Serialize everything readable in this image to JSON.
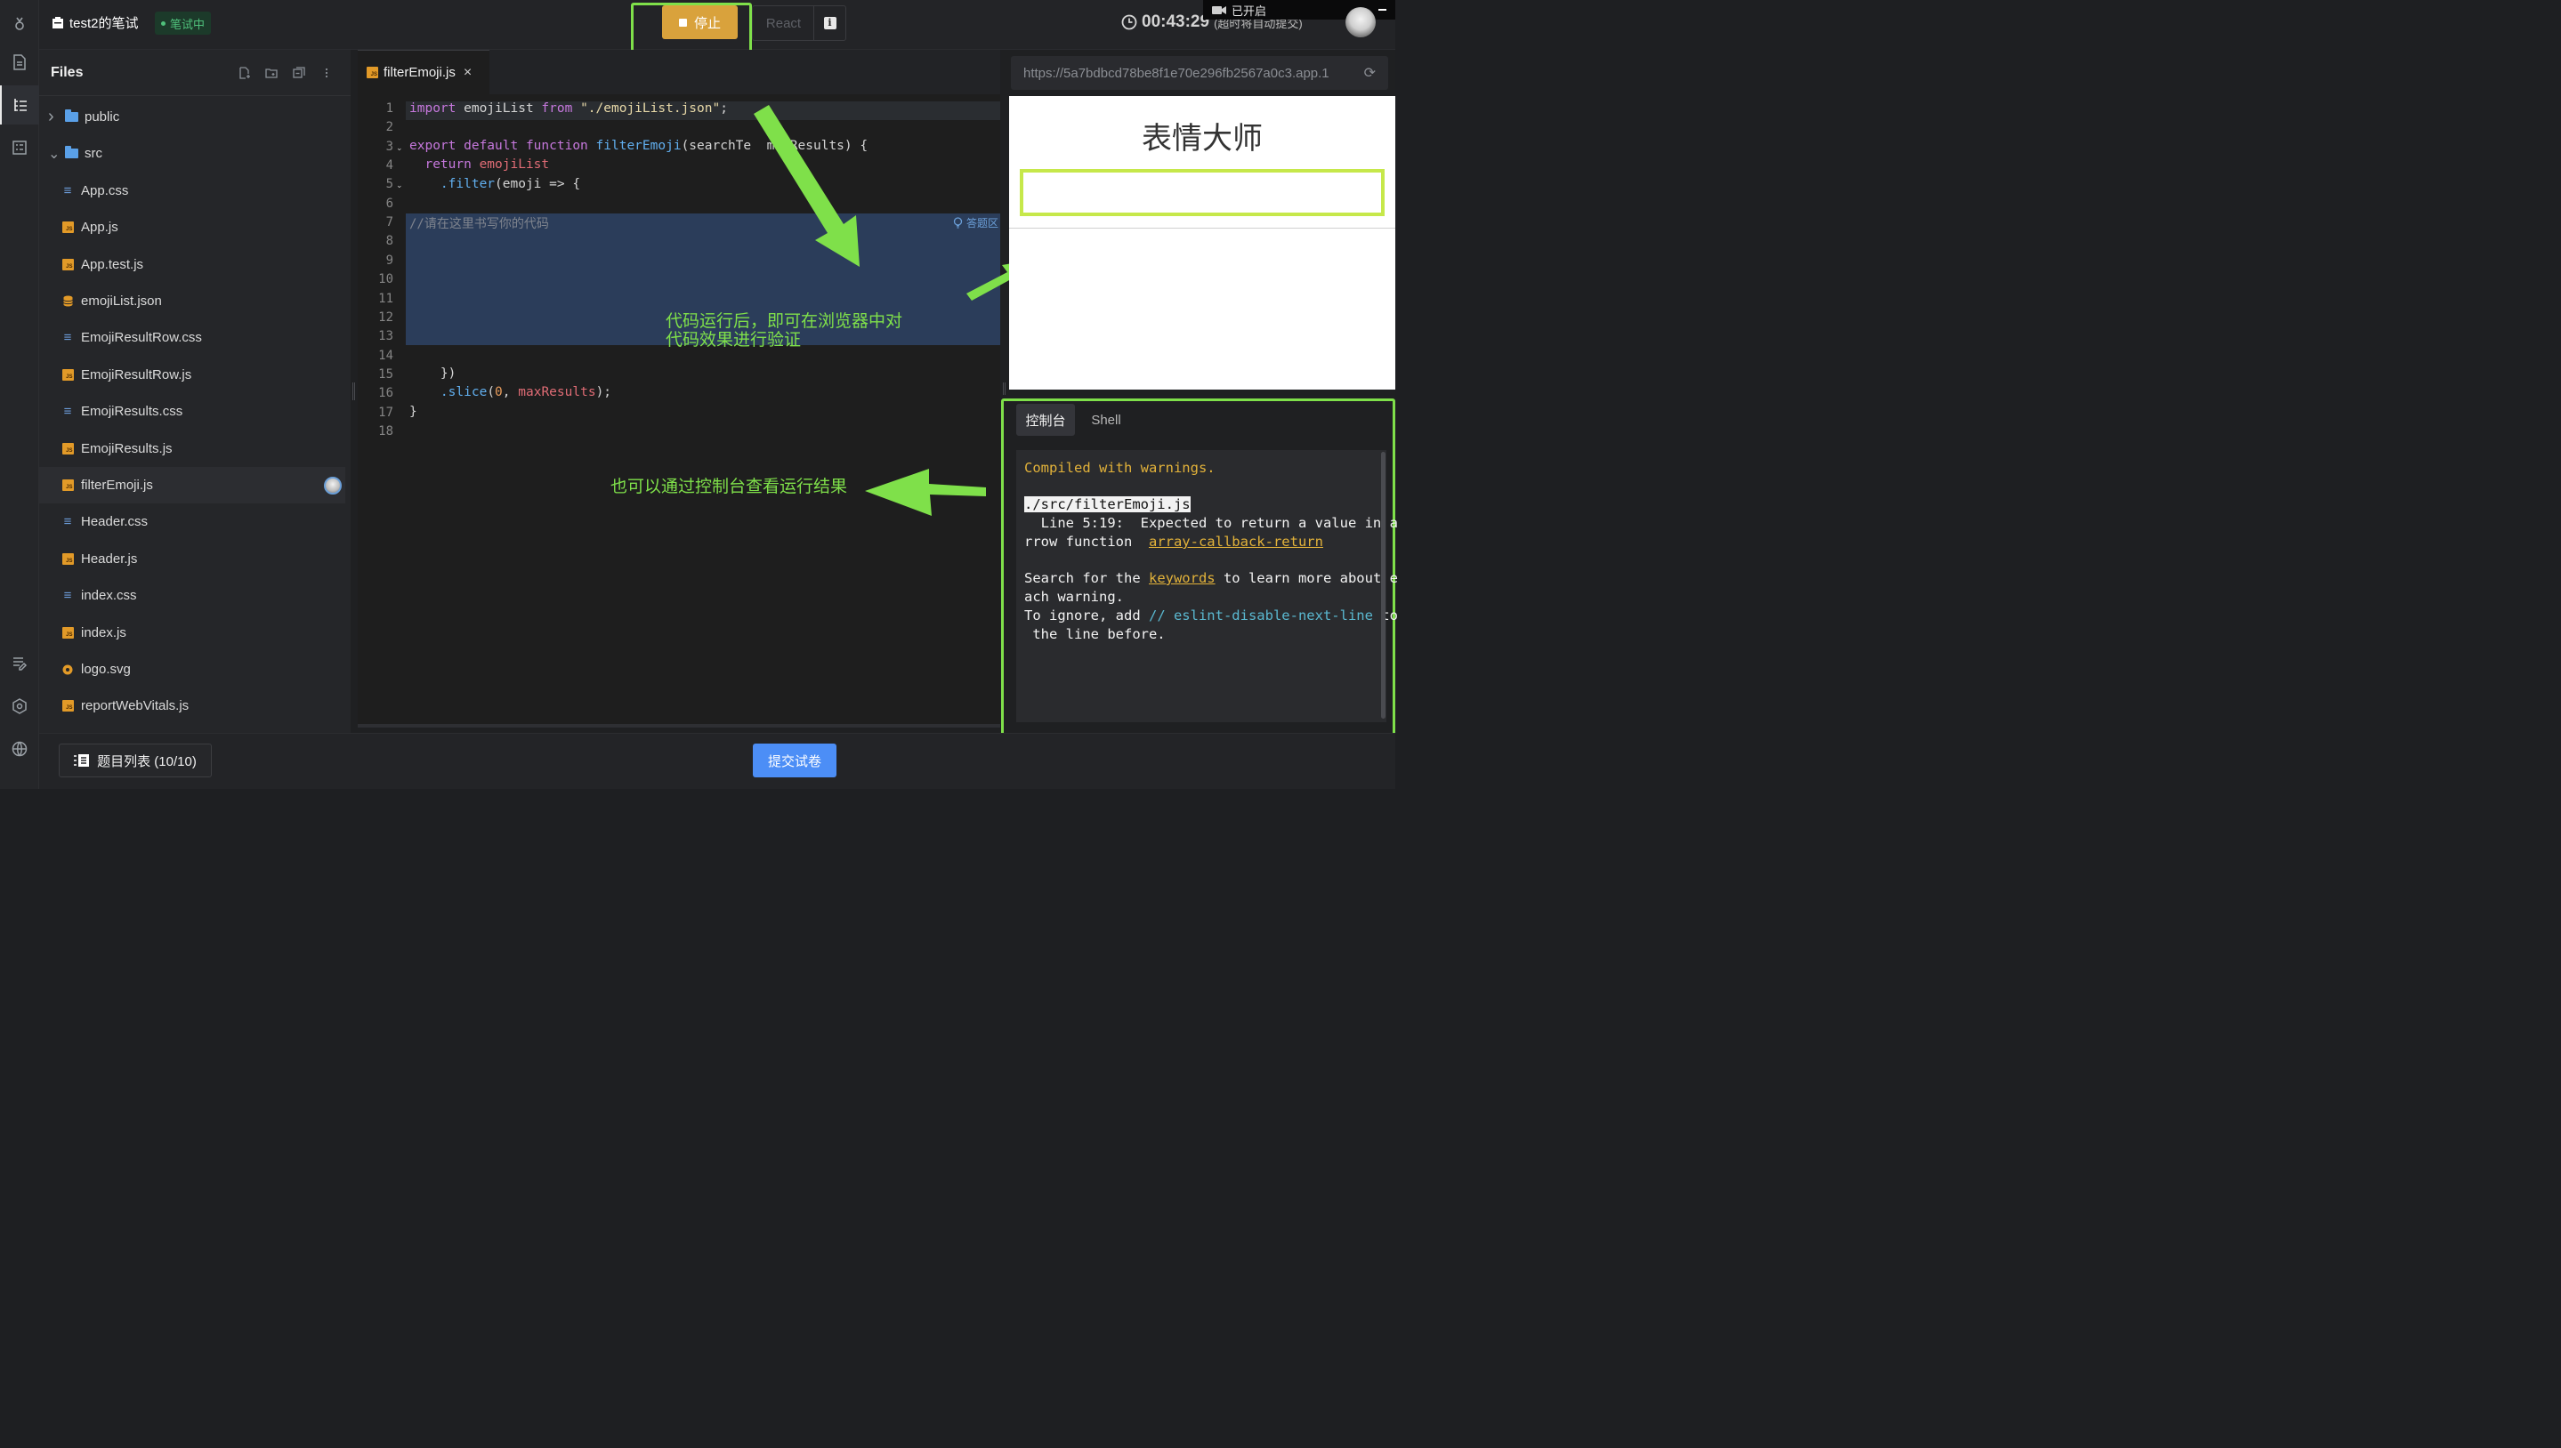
{
  "app": {
    "title": "test2的笔试",
    "status": "笔试中",
    "stop_label": "停止",
    "framework_label": "React",
    "info_label": "i",
    "timer": "00:43:29",
    "timer_note": "(超时将自动提交)",
    "camera_status": "已开启"
  },
  "files": {
    "title": "Files",
    "items": [
      {
        "label": "public",
        "type": "folder",
        "expanded": false
      },
      {
        "label": "src",
        "type": "folder",
        "expanded": true
      },
      {
        "label": "App.css",
        "type": "css"
      },
      {
        "label": "App.js",
        "type": "js"
      },
      {
        "label": "App.test.js",
        "type": "js"
      },
      {
        "label": "emojiList.json",
        "type": "json"
      },
      {
        "label": "EmojiResultRow.css",
        "type": "css"
      },
      {
        "label": "EmojiResultRow.js",
        "type": "js"
      },
      {
        "label": "EmojiResults.css",
        "type": "css"
      },
      {
        "label": "EmojiResults.js",
        "type": "js"
      },
      {
        "label": "filterEmoji.js",
        "type": "js",
        "selected": true
      },
      {
        "label": "Header.css",
        "type": "css"
      },
      {
        "label": "Header.js",
        "type": "js"
      },
      {
        "label": "index.css",
        "type": "css"
      },
      {
        "label": "index.js",
        "type": "js"
      },
      {
        "label": "logo.svg",
        "type": "svg"
      },
      {
        "label": "reportWebVitals.js",
        "type": "js"
      }
    ]
  },
  "editor": {
    "tab_label": "filterEmoji.js",
    "tab_close": "×",
    "answer_zone_label": "答题区",
    "line_numbers": [
      "1",
      "2",
      "3",
      "4",
      "5",
      "6",
      "7",
      "8",
      "9",
      "10",
      "11",
      "12",
      "13",
      "14",
      "15",
      "16",
      "17",
      "18"
    ],
    "lines": {
      "l1_import": "import",
      "l1_name": " emojiList ",
      "l1_from": "from",
      "l1_path": " \"./emojiList.json\"",
      "l1_semi": ";",
      "l3_export": "export default function",
      "l3_fn": " filterEmoji",
      "l3_params": "(searchTe",
      "l3_rest": "  maxResults) {",
      "l4_return": "  return",
      "l4_var": " emojiList",
      "l5_filter": "    .filter",
      "l5_rest": "(emoji => {",
      "l7_comment": "//请在这里书写你的代码",
      "l15": "    })",
      "l16_slice": "    .slice",
      "l16_open": "(",
      "l16_zero": "0",
      "l16_comma": ", ",
      "l16_max": "maxResults",
      "l16_close": ");",
      "l17": "}"
    }
  },
  "annotations": {
    "run_note_line1": "代码运行后，即可在浏览器中对",
    "run_note_line2": "代码效果进行验证",
    "console_note": "也可以通过控制台查看运行结果"
  },
  "preview": {
    "url": "https://5a7bdbcd78be8f1e70e296fb2567a0c3.app.1",
    "refresh_icon": "⟳",
    "app_title": "表情大师"
  },
  "console": {
    "tabs": [
      "控制台",
      "Shell"
    ],
    "line1": "Compiled with warnings.",
    "path": "./src/filterEmoji.js",
    "line3": "  Line 5:19:  Expected to return a value in a",
    "line4_a": "rrow function  ",
    "line4_link": "array-callback-return",
    "line5_a": "Search for the ",
    "line5_link": "keywords",
    "line5_b": " to learn more about e",
    "line6": "ach warning.",
    "line7_a": "To ignore, add ",
    "line7_cmt": "// eslint-disable-next-line",
    "line7_b": " to",
    "line8": " the line before."
  },
  "footer": {
    "question_list": "题目列表 (10/10)",
    "submit": "提交试卷"
  }
}
